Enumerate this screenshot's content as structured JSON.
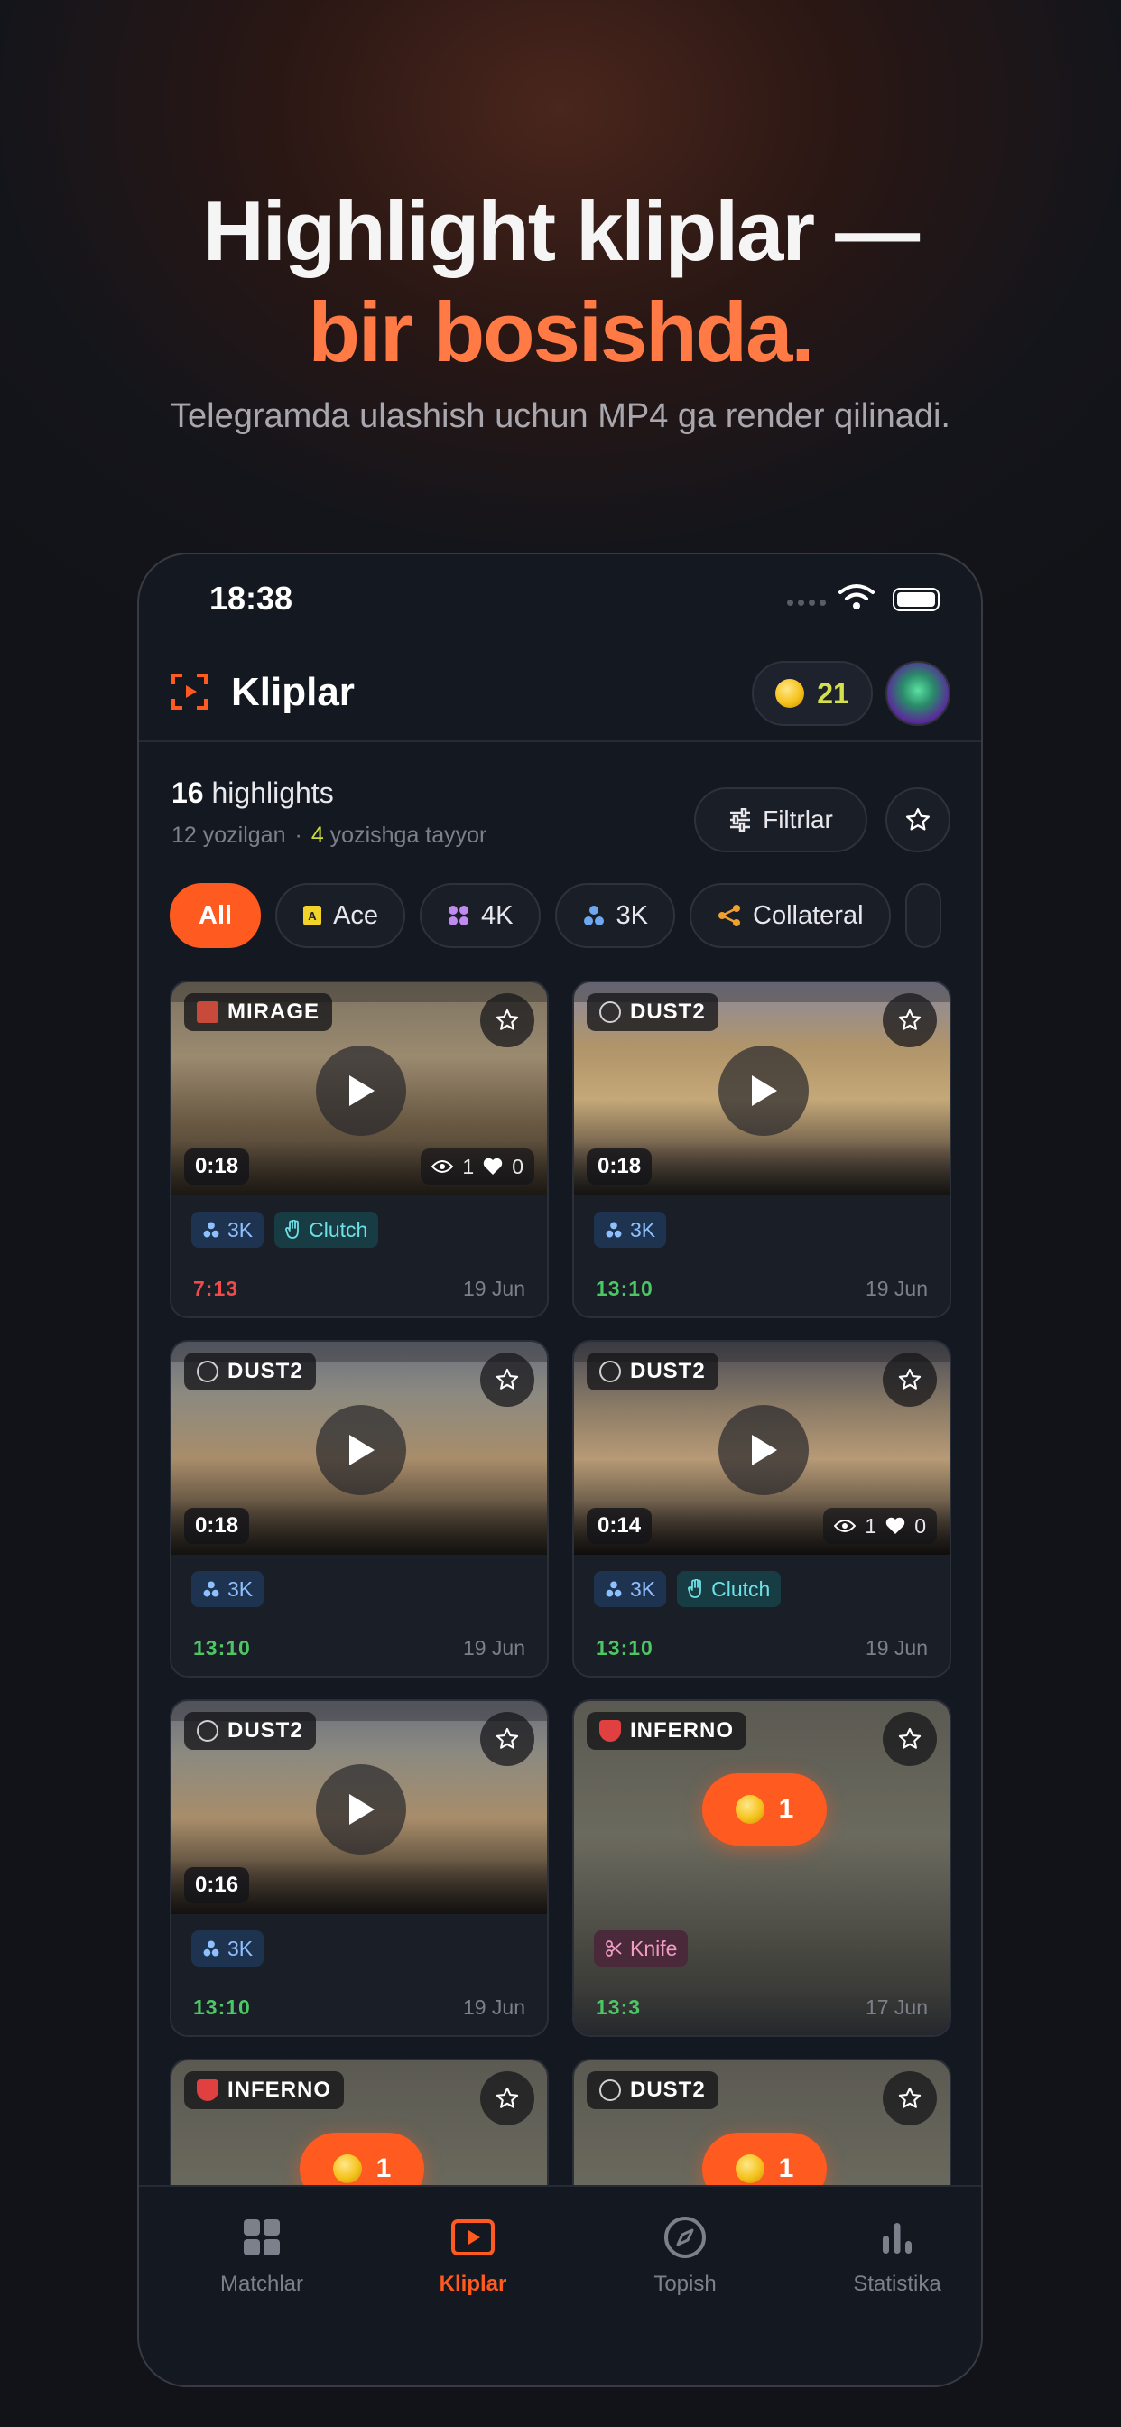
{
  "hero": {
    "title_line1": "Highlight kliplar —",
    "title_line2": "bir bosishda.",
    "subtitle": "Telegramda ulashish uchun MP4 ga render qilinadi."
  },
  "status_bar": {
    "time": "18:38"
  },
  "app_bar": {
    "title": "Kliplar",
    "coins": "21"
  },
  "summary": {
    "count": "16",
    "count_label": "highlights",
    "written": "12 yozilgan",
    "separator": "·",
    "ready_count": "4",
    "ready_label": "yozishga tayyor"
  },
  "filter_button": {
    "label": "Filtrlar"
  },
  "chips": [
    {
      "label": "All",
      "icon": ""
    },
    {
      "label": "Ace",
      "icon": "ace-icon"
    },
    {
      "label": "4K",
      "icon": "4k-icon"
    },
    {
      "label": "3K",
      "icon": "3k-icon"
    },
    {
      "label": "Collateral",
      "icon": "collateral-icon"
    }
  ],
  "clips": [
    {
      "map": "MIRAGE",
      "duration": "0:18",
      "views": "1",
      "likes": "0",
      "tags": [
        "3K",
        "Clutch"
      ],
      "score": "7:13",
      "result": "loss",
      "date": "19 Jun"
    },
    {
      "map": "DUST2",
      "duration": "0:18",
      "tags": [
        "3K"
      ],
      "score": "13:10",
      "result": "win",
      "date": "19 Jun"
    },
    {
      "map": "DUST2",
      "duration": "0:18",
      "tags": [
        "3K"
      ],
      "score": "13:10",
      "result": "win",
      "date": "19 Jun"
    },
    {
      "map": "DUST2",
      "duration": "0:14",
      "views": "1",
      "likes": "0",
      "tags": [
        "3K",
        "Clutch"
      ],
      "score": "13:10",
      "result": "win",
      "date": "19 Jun"
    },
    {
      "map": "DUST2",
      "duration": "0:16",
      "tags": [
        "3K"
      ],
      "score": "13:10",
      "result": "win",
      "date": "19 Jun"
    },
    {
      "map": "INFERNO",
      "locked": true,
      "unlock_cost": "1",
      "tags": [
        "Knife"
      ],
      "score": "13:3",
      "result": "win",
      "date": "17 Jun"
    },
    {
      "map": "INFERNO",
      "locked": true,
      "unlock_cost": "1"
    },
    {
      "map": "DUST2",
      "locked": true,
      "unlock_cost": "1"
    }
  ],
  "tabs": [
    {
      "label": "Matchlar",
      "icon": "grid-icon"
    },
    {
      "label": "Kliplar",
      "icon": "play-square-icon",
      "active": true
    },
    {
      "label": "Topish",
      "icon": "compass-icon"
    },
    {
      "label": "Statistika",
      "icon": "bar-chart-icon"
    }
  ],
  "colors": {
    "accent": "#ff5a1f",
    "hero_accent": "#ff7a45",
    "win": "#4cc764",
    "loss": "#ef4b4b",
    "coin_text": "#d4e04a"
  }
}
